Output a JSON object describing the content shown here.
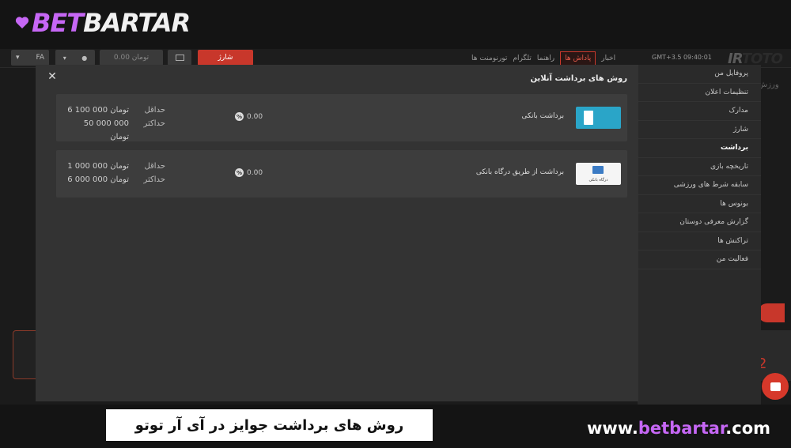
{
  "brand": {
    "part1": "BET",
    "part2": "BARTAR",
    "url_prefix": "www.",
    "url_accent": "betbartar",
    "url_suffix": ".com"
  },
  "header": {
    "lang": "FA",
    "balance_placeholder": "0.00 تومان",
    "charge_label": "شارژ",
    "nav": [
      "تورنومنت ها",
      "تلگرام",
      "راهنما",
      "پاداش ها",
      "اخبار"
    ],
    "active_nav_index": 3,
    "time": "GMT+3.5  09:40:01",
    "logo_part1": "IR",
    "logo_part2": "TOTO"
  },
  "side_menu": {
    "items": [
      "پروفایل من",
      "تنظیمات اعلان",
      "مدارک",
      "شارژ",
      "برداشت",
      "تاریخچه بازی",
      "سابقه شرط های ورزشی",
      "بونوس ها",
      "گزارش معرفی دوستان",
      "تراکنش ها",
      "فعالیت من"
    ],
    "active_index": 4
  },
  "background": {
    "right_text": "ورزش",
    "right_number": "2"
  },
  "modal": {
    "title": "روش های برداشت آنلاین",
    "methods": [
      {
        "name": "برداشت بانکی",
        "thumb_label": "",
        "percent": "0.00",
        "min_label": "حداقل",
        "min_value": "6 100 000 تومان",
        "max_label": "حداکثر",
        "max_value": "50 000 000 تومان"
      },
      {
        "name": "برداشت از طریق درگاه بانکی",
        "thumb_label": "درگاه بانکی",
        "percent": "0.00",
        "min_label": "حداقل",
        "min_value": "1 000 000 تومان",
        "max_label": "حداکثر",
        "max_value": "6 000 000 تومان"
      }
    ]
  },
  "caption": "روش های برداشت جوایز در آی آر توتو",
  "colors": {
    "accent_red": "#c8372b",
    "brand_purple": "#c667f5",
    "modal_bg": "#333333",
    "row_bg": "#3d3d3d"
  }
}
